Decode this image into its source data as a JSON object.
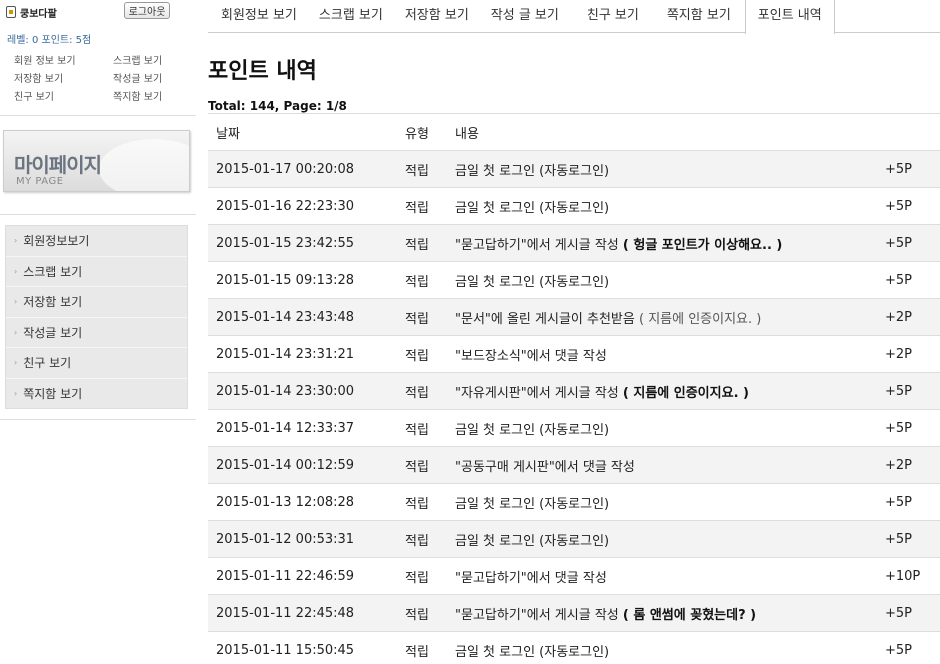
{
  "sidebar": {
    "user_name": "쿵보다팔",
    "logout_label": "로그아웃",
    "stats": "레벨: 0  포인트: 5점",
    "quick_links": [
      "회원 정보 보기",
      "스크랩 보기",
      "저장함 보기",
      "작성글 보기",
      "친구 보기",
      "쪽지함 보기"
    ],
    "banner_title": "마이페이지",
    "banner_sub": "MY PAGE",
    "nav": [
      "회원정보보기",
      "스크랩 보기",
      "저장함 보기",
      "작성글 보기",
      "친구 보기",
      "쪽지함 보기"
    ]
  },
  "tabs": [
    "회원정보 보기",
    "스크랩 보기",
    "저장함 보기",
    "작성 글 보기",
    "친구 보기",
    "쪽지함 보기",
    "포인트 내역"
  ],
  "active_tab": "포인트 내역",
  "page_title": "포인트 내역",
  "total_line": "Total: 144, Page: 1/8",
  "table": {
    "headers": [
      "날짜",
      "유형",
      "내용",
      ""
    ],
    "rows": [
      {
        "date": "2015-01-17 00:20:08",
        "type": "적립",
        "desc": "금일 첫 로그인 (자동로그인)",
        "link": "",
        "points": "+5P"
      },
      {
        "date": "2015-01-16 22:23:30",
        "type": "적립",
        "desc": "금일 첫 로그인 (자동로그인)",
        "link": "",
        "points": "+5P"
      },
      {
        "date": "2015-01-15 23:42:55",
        "type": "적립",
        "desc": "\"묻고답하기\"에서 게시글 작성",
        "link": "( 헝글 포인트가 이상해요.. )",
        "points": "+5P"
      },
      {
        "date": "2015-01-15 09:13:28",
        "type": "적립",
        "desc": "금일 첫 로그인 (자동로그인)",
        "link": "",
        "points": "+5P"
      },
      {
        "date": "2015-01-14 23:43:48",
        "type": "적립",
        "desc": "\"문서\"에 올린 게시글이 추천받음",
        "link": "( 지름에 인증이지요. )",
        "link_light": true,
        "points": "+2P"
      },
      {
        "date": "2015-01-14 23:31:21",
        "type": "적립",
        "desc": "\"보드장소식\"에서 댓글 작성",
        "link": "",
        "points": "+2P"
      },
      {
        "date": "2015-01-14 23:30:00",
        "type": "적립",
        "desc": "\"자유게시판\"에서 게시글 작성",
        "link": "( 지름에 인증이지요. )",
        "points": "+5P"
      },
      {
        "date": "2015-01-14 12:33:37",
        "type": "적립",
        "desc": "금일 첫 로그인 (자동로그인)",
        "link": "",
        "points": "+5P"
      },
      {
        "date": "2015-01-14 00:12:59",
        "type": "적립",
        "desc": "\"공동구매 게시판\"에서 댓글 작성",
        "link": "",
        "points": "+2P"
      },
      {
        "date": "2015-01-13 12:08:28",
        "type": "적립",
        "desc": "금일 첫 로그인 (자동로그인)",
        "link": "",
        "points": "+5P"
      },
      {
        "date": "2015-01-12 00:53:31",
        "type": "적립",
        "desc": "금일 첫 로그인 (자동로그인)",
        "link": "",
        "points": "+5P"
      },
      {
        "date": "2015-01-11 22:46:59",
        "type": "적립",
        "desc": "\"묻고답하기\"에서 댓글 작성",
        "link": "",
        "points": "+10P"
      },
      {
        "date": "2015-01-11 22:45:48",
        "type": "적립",
        "desc": "\"묻고답하기\"에서 게시글 작성",
        "link": "( 롬 앤썸에 꽂혔는데? )",
        "points": "+5P"
      },
      {
        "date": "2015-01-11 15:50:45",
        "type": "적립",
        "desc": "금일 첫 로그인 (자동로그인)",
        "link": "",
        "points": "+5P"
      }
    ]
  }
}
